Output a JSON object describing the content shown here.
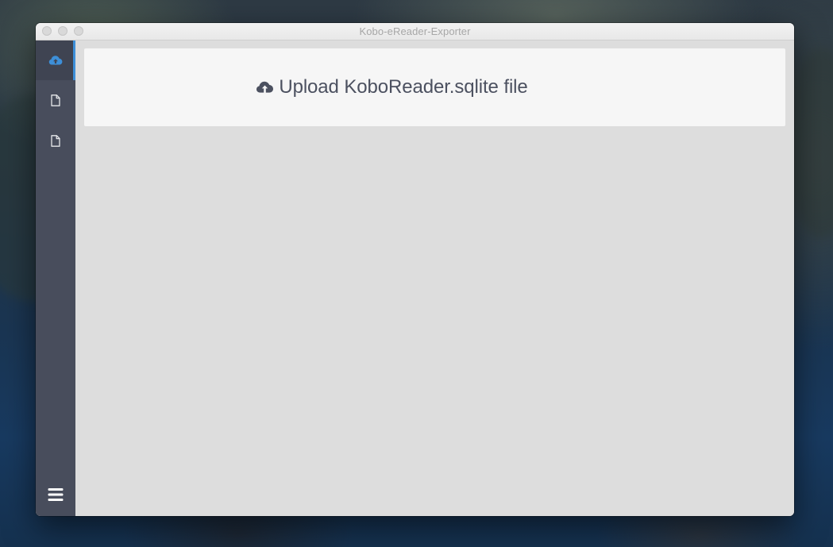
{
  "window": {
    "title": "Kobo-eReader-Exporter"
  },
  "sidebar": {
    "items": [
      {
        "id": "upload",
        "icon": "cloud-upload-icon",
        "active": true
      },
      {
        "id": "document-1",
        "icon": "document-icon",
        "active": false
      },
      {
        "id": "document-2",
        "icon": "document-icon",
        "active": false
      }
    ],
    "menu_icon": "hamburger-menu-icon"
  },
  "main": {
    "upload_label": "Upload KoboReader.sqlite file",
    "upload_icon": "cloud-upload-icon"
  },
  "colors": {
    "sidebar_bg": "#484d5c",
    "accent": "#3d8fd8",
    "content_bg": "#dddddd",
    "panel_bg": "#f6f6f6",
    "text": "#4c5160"
  }
}
